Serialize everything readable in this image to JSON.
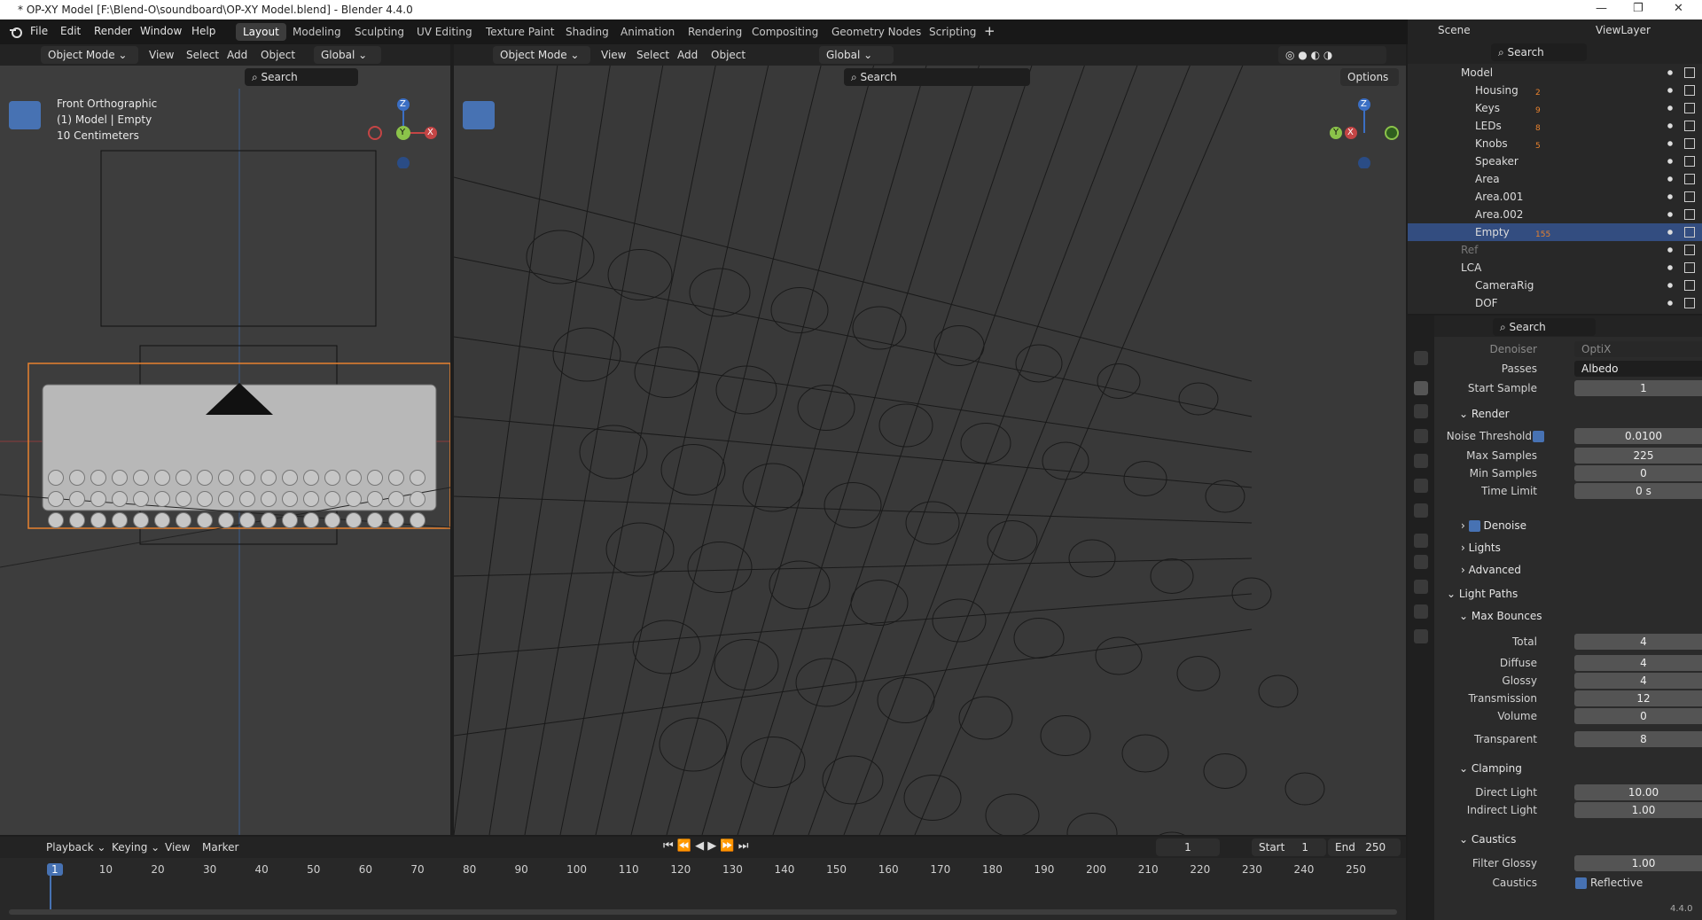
{
  "window": {
    "title": "* OP-XY Model [F:\\Blend-O\\soundboard\\OP-XY Model.blend] - Blender 4.4.0"
  },
  "menubar": {
    "items": [
      "File",
      "Edit",
      "Render",
      "Window",
      "Help"
    ],
    "workspaces": [
      "Layout",
      "Modeling",
      "Sculpting",
      "UV Editing",
      "Texture Paint",
      "Shading",
      "Animation",
      "Rendering",
      "Compositing",
      "Geometry Nodes",
      "Scripting"
    ],
    "active_workspace": "Layout",
    "scene": "Scene",
    "view_layer": "ViewLayer"
  },
  "viewport_left": {
    "mode": "Object Mode",
    "menus": [
      "View",
      "Select",
      "Add",
      "Object"
    ],
    "orientation": "Global",
    "search_placeholder": "Search",
    "overlay_lines": [
      "Front Orthographic",
      "(1) Model | Empty",
      "10 Centimeters"
    ],
    "gizmo": {
      "z": "Z",
      "y": "Y",
      "x": "X"
    }
  },
  "viewport_right": {
    "mode": "Object Mode",
    "menus": [
      "View",
      "Select",
      "Add",
      "Object"
    ],
    "orientation": "Global",
    "search_placeholder": "Search",
    "options_label": "Options",
    "gizmo": {
      "z": "Z",
      "y": "Y",
      "x": "X"
    }
  },
  "timeline": {
    "menus": [
      "Playback",
      "Keying",
      "View",
      "Marker"
    ],
    "current_frame": "1",
    "start_label": "Start",
    "start": "1",
    "end_label": "End",
    "end": "250",
    "ruler": [
      "1",
      "10",
      "20",
      "30",
      "40",
      "50",
      "60",
      "70",
      "80",
      "90",
      "100",
      "110",
      "120",
      "130",
      "140",
      "150",
      "160",
      "170",
      "180",
      "190",
      "200",
      "210",
      "220",
      "230",
      "240",
      "250"
    ]
  },
  "outliner": {
    "search_placeholder": "Search",
    "rows": [
      {
        "label": "Model",
        "badge": ""
      },
      {
        "label": "Housing",
        "badge": "2"
      },
      {
        "label": "Keys",
        "badge": "9"
      },
      {
        "label": "LEDs",
        "badge": "8"
      },
      {
        "label": "Knobs",
        "badge": "5"
      },
      {
        "label": "Speaker",
        "badge": ""
      },
      {
        "label": "Area",
        "badge": ""
      },
      {
        "label": "Area.001",
        "badge": ""
      },
      {
        "label": "Area.002",
        "badge": ""
      },
      {
        "label": "Empty",
        "badge": "155"
      },
      {
        "label": "Ref",
        "badge": ""
      },
      {
        "label": "LCA",
        "badge": ""
      },
      {
        "label": "CameraRig",
        "badge": ""
      },
      {
        "label": "DOF",
        "badge": ""
      }
    ]
  },
  "properties": {
    "search_placeholder": "Search",
    "denoiser_label": "Denoiser",
    "denoiser_value": "OptiX",
    "passes_label": "Passes",
    "passes_value": "Albedo",
    "start_sample_label": "Start Sample",
    "start_sample_value": "1",
    "render_section": "Render",
    "noise_threshold_label": "Noise Threshold",
    "noise_threshold_value": "0.0100",
    "max_samples_label": "Max Samples",
    "max_samples_value": "225",
    "min_samples_label": "Min Samples",
    "min_samples_value": "0",
    "time_limit_label": "Time Limit",
    "time_limit_value": "0 s",
    "denoise_section": "Denoise",
    "lights_section": "Lights",
    "advanced_section": "Advanced",
    "light_paths_section": "Light Paths",
    "max_bounces_section": "Max Bounces",
    "total_label": "Total",
    "total_value": "4",
    "diffuse_label": "Diffuse",
    "diffuse_value": "4",
    "glossy_label": "Glossy",
    "glossy_value": "4",
    "transmission_label": "Transmission",
    "transmission_value": "12",
    "volume_label": "Volume",
    "volume_value": "0",
    "transparent_label": "Transparent",
    "transparent_value": "8",
    "clamping_section": "Clamping",
    "direct_light_label": "Direct Light",
    "direct_light_value": "10.00",
    "indirect_light_label": "Indirect Light",
    "indirect_light_value": "1.00",
    "caustics_section": "Caustics",
    "filter_glossy_label": "Filter Glossy",
    "filter_glossy_value": "1.00",
    "caustics_label": "Caustics",
    "reflective_label": "Reflective"
  },
  "statusbar": {
    "version": "4.4.0"
  },
  "colors": {
    "accent": "#4772b3",
    "selection": "#334d80",
    "orange": "#e8822e"
  }
}
